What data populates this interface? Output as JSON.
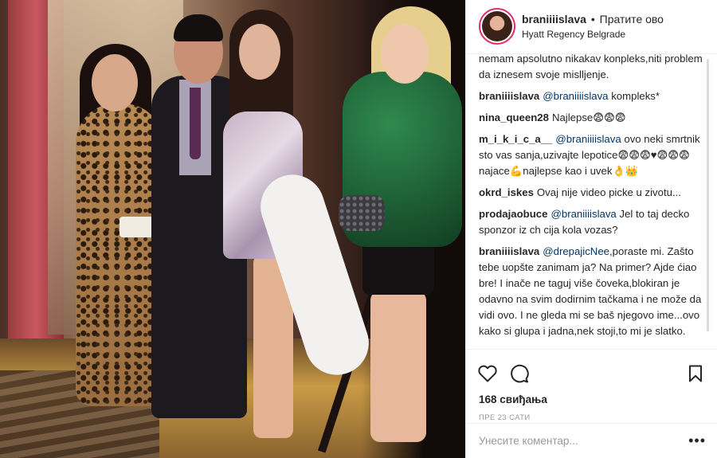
{
  "header": {
    "username": "braniiiislava",
    "separator": "•",
    "follow_label": "Пратите ово",
    "location": "Hyatt Regency Belgrade"
  },
  "comments": [
    {
      "user": "",
      "mention": "",
      "text": "nemam apsolutno nikakav konpleks,niti problem da iznesem svoje mislljenje."
    },
    {
      "user": "braniiiislava",
      "mention": "@braniiiislava",
      "text": " kompleks*"
    },
    {
      "user": "nina_queen28",
      "mention": "",
      "text": "Najlepse😨😨😨"
    },
    {
      "user": "m_i_k_i_c_a__",
      "mention": "@braniiiislava",
      "text": " ovo neki smrtnik sto vas sanja,uzivajte lepotice😨😨😨♥😨😨😨najace💪najlepse kao i uvek👌👑"
    },
    {
      "user": "okrd_iskes",
      "mention": "",
      "text": "Ovaj nije video picke u zivotu..."
    },
    {
      "user": "prodajaobuce",
      "mention": "@braniiiislava",
      "text": " Jel to taj decko sponzor iz ch cija kola vozas?"
    },
    {
      "user": "braniiiislava",
      "mention": "@drepajicNee",
      "text": ",poraste mi. Zašto tebe uopšte zanimam ja? Na primer? Ajde ćiao bre! I inače ne taguj više čoveka,blokiran je odavno na svim dodirnim tačkama i ne može da vidi ovo. I ne gleda mi se baš njegovo ime...ovo kako si glupa i jadna,nek stoji,to mi je slatko."
    }
  ],
  "actions": {
    "like_icon": "heart-icon",
    "comment_icon": "comment-bubble-icon",
    "save_icon": "bookmark-icon"
  },
  "likes": "168 свиђања",
  "time": "ПРЕ 23 САТИ",
  "add_comment": {
    "placeholder": "Унесите коментар...",
    "more": "•••"
  },
  "colors": {
    "story_ring": "#e1306c",
    "mention": "#003569"
  }
}
